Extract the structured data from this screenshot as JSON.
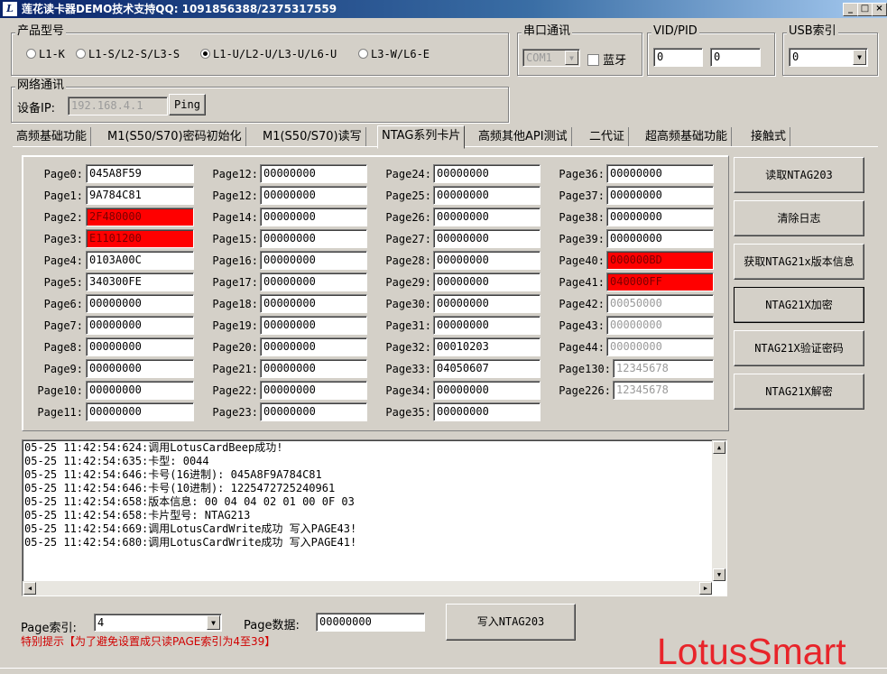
{
  "window": {
    "title": "莲花读卡器DEMO技术支持QQ: 1091856388/2375317559",
    "logo": "L",
    "controls": [
      "_",
      "□",
      "×"
    ]
  },
  "product_group": {
    "title": "产品型号",
    "options": [
      "L1-K",
      "L1-S/L2-S/L3-S",
      "L1-U/L2-U/L3-U/L6-U",
      "L3-W/L6-E"
    ],
    "selected_index": 2
  },
  "serial_group": {
    "title": "串口通讯",
    "port": "COM1",
    "bluetooth_label": "蓝牙"
  },
  "vidpid_group": {
    "title": "VID/PID",
    "vid": "0",
    "pid": "0"
  },
  "usb_group": {
    "title": "USB索引",
    "value": "0"
  },
  "network_group": {
    "title": "网络通讯",
    "ip_label": "设备IP:",
    "ip_value": "192.168.4.1",
    "ping_label": "Ping"
  },
  "tabs": [
    "高频基础功能",
    "M1(S50/S70)密码初始化",
    "M1(S50/S70)读写",
    "NTAG系列卡片",
    "高频其他API测试",
    "二代证",
    "超高频基础功能",
    "接触式"
  ],
  "active_tab": 3,
  "pages": {
    "col1": [
      {
        "label": "Page0:",
        "value": "045A8F59",
        "style": ""
      },
      {
        "label": "Page1:",
        "value": "9A784C81",
        "style": ""
      },
      {
        "label": "Page2:",
        "value": "2F480000",
        "style": "red"
      },
      {
        "label": "Page3:",
        "value": "E1101200",
        "style": "red"
      },
      {
        "label": "Page4:",
        "value": "0103A00C",
        "style": ""
      },
      {
        "label": "Page5:",
        "value": "340300FE",
        "style": ""
      },
      {
        "label": "Page6:",
        "value": "00000000",
        "style": ""
      },
      {
        "label": "Page7:",
        "value": "00000000",
        "style": ""
      },
      {
        "label": "Page8:",
        "value": "00000000",
        "style": ""
      },
      {
        "label": "Page9:",
        "value": "00000000",
        "style": ""
      },
      {
        "label": "Page10:",
        "value": "00000000",
        "style": ""
      },
      {
        "label": "Page11:",
        "value": "00000000",
        "style": ""
      }
    ],
    "col2": [
      {
        "label": "Page12:",
        "value": "00000000",
        "style": ""
      },
      {
        "label": "Page12:",
        "value": "00000000",
        "style": ""
      },
      {
        "label": "Page14:",
        "value": "00000000",
        "style": ""
      },
      {
        "label": "Page15:",
        "value": "00000000",
        "style": ""
      },
      {
        "label": "Page16:",
        "value": "00000000",
        "style": ""
      },
      {
        "label": "Page17:",
        "value": "00000000",
        "style": ""
      },
      {
        "label": "Page18:",
        "value": "00000000",
        "style": ""
      },
      {
        "label": "Page19:",
        "value": "00000000",
        "style": ""
      },
      {
        "label": "Page20:",
        "value": "00000000",
        "style": ""
      },
      {
        "label": "Page21:",
        "value": "00000000",
        "style": ""
      },
      {
        "label": "Page22:",
        "value": "00000000",
        "style": ""
      },
      {
        "label": "Page23:",
        "value": "00000000",
        "style": ""
      }
    ],
    "col3": [
      {
        "label": "Page24:",
        "value": "00000000",
        "style": ""
      },
      {
        "label": "Page25:",
        "value": "00000000",
        "style": ""
      },
      {
        "label": "Page26:",
        "value": "00000000",
        "style": ""
      },
      {
        "label": "Page27:",
        "value": "00000000",
        "style": ""
      },
      {
        "label": "Page28:",
        "value": "00000000",
        "style": ""
      },
      {
        "label": "Page29:",
        "value": "00000000",
        "style": ""
      },
      {
        "label": "Page30:",
        "value": "00000000",
        "style": ""
      },
      {
        "label": "Page31:",
        "value": "00000000",
        "style": ""
      },
      {
        "label": "Page32:",
        "value": "00010203",
        "style": ""
      },
      {
        "label": "Page33:",
        "value": "04050607",
        "style": ""
      },
      {
        "label": "Page34:",
        "value": "00000000",
        "style": ""
      },
      {
        "label": "Page35:",
        "value": "00000000",
        "style": ""
      }
    ],
    "col4": [
      {
        "label": "Page36:",
        "value": "00000000",
        "style": ""
      },
      {
        "label": "Page37:",
        "value": "00000000",
        "style": ""
      },
      {
        "label": "Page38:",
        "value": "00000000",
        "style": ""
      },
      {
        "label": "Page39:",
        "value": "00000000",
        "style": ""
      },
      {
        "label": "Page40:",
        "value": "000000BD",
        "style": "red"
      },
      {
        "label": "Page41:",
        "value": "040000FF",
        "style": "red"
      },
      {
        "label": "Page42:",
        "value": "00050000",
        "style": "gray"
      },
      {
        "label": "Page43:",
        "value": "00000000",
        "style": "gray"
      },
      {
        "label": "Page44:",
        "value": "00000000",
        "style": "gray"
      },
      {
        "label": "Page130:",
        "value": "12345678",
        "style": "gray"
      },
      {
        "label": "Page226:",
        "value": "12345678",
        "style": "gray"
      }
    ]
  },
  "actions": [
    "读取NTAG203",
    "清除日志",
    "获取NTAG21x版本信息",
    "NTAG21X加密",
    "NTAG21X验证密码",
    "NTAG21X解密"
  ],
  "log": [
    "05-25 11:42:54:624:调用LotusCardBeep成功!",
    "05-25 11:42:54:635:卡型: 0044",
    "05-25 11:42:54:646:卡号(16进制): 045A8F9A784C81",
    "05-25 11:42:54:646:卡号(10进制): 1225472725240961",
    "05-25 11:42:54:658:版本信息:  00 04 04 02 01 00 0F 03",
    "05-25 11:42:54:658:卡片型号: NTAG213",
    "05-25 11:42:54:669:调用LotusCardWrite成功 写入PAGE43!",
    "05-25 11:42:54:680:调用LotusCardWrite成功 写入PAGE41!"
  ],
  "bottom": {
    "page_index_label": "Page索引:",
    "page_index_value": "4",
    "page_data_label": "Page数据:",
    "page_data_value": "00000000",
    "write_button": "写入NTAG203",
    "hint": "特别提示【为了避免设置成只读PAGE索引为4至39】"
  },
  "brand": "LotusSmart",
  "colors": {
    "highlight": "#ff0000",
    "titlebar": "#0a246a",
    "brand": "#e8242a",
    "hint": "#d00000"
  }
}
